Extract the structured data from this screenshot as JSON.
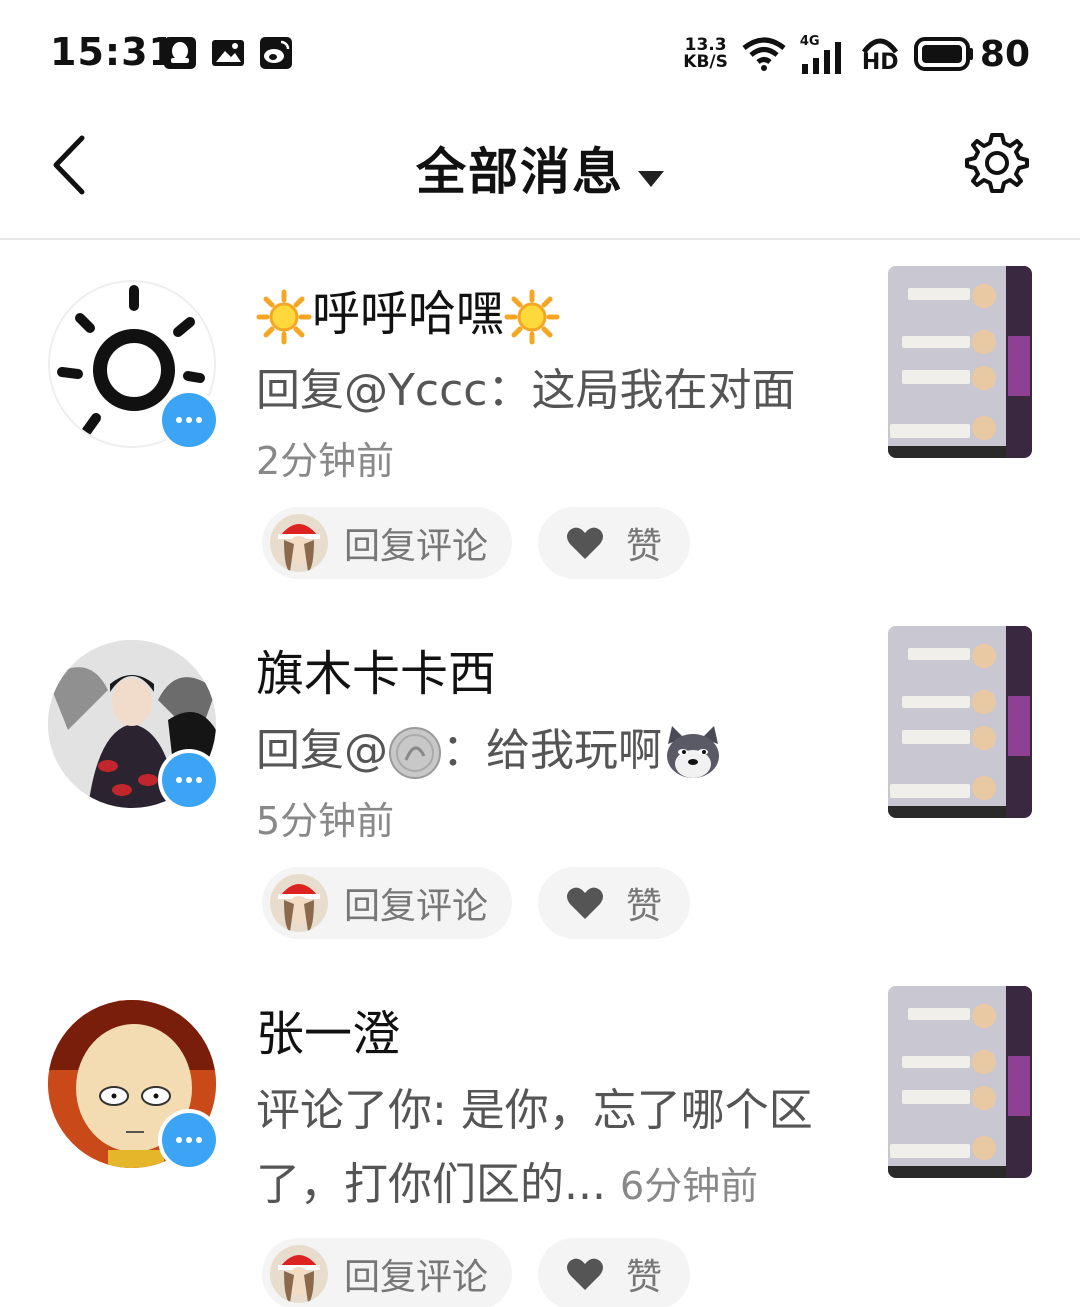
{
  "status_bar": {
    "time": "15:31",
    "net_speed_top": "13.3",
    "net_speed_bottom": "KB/S",
    "network_type": "4G",
    "hd_label": "HD",
    "battery": "80",
    "icons": [
      "qq-icon",
      "gallery-icon",
      "weibo-icon",
      "wifi-icon",
      "signal-icon",
      "hd-call-icon",
      "battery-icon"
    ]
  },
  "header": {
    "title": "全部消息",
    "back_icon": "chevron-left-icon",
    "settings_icon": "gear-icon"
  },
  "messages": [
    {
      "name": "呼呼哈嘿",
      "message": "回复@Yccc：这局我在对面",
      "time": "2分钟前",
      "reply_label": "回复评论",
      "like_label": "赞"
    },
    {
      "name": "旗木卡卡西",
      "message_prefix": "回复@",
      "message_suffix": "：给我玩啊",
      "time": "5分钟前",
      "reply_label": "回复评论",
      "like_label": "赞"
    },
    {
      "name": "张一澄",
      "message": "评论了你: 是你，忘了哪个区了，打你们区的...",
      "time": "6分钟前",
      "reply_label": "回复评论",
      "like_label": "赞"
    }
  ],
  "colors": {
    "badge_blue": "#3ba4f5",
    "pill_bg": "#f4f4f5",
    "divider": "#e6e6e6"
  }
}
